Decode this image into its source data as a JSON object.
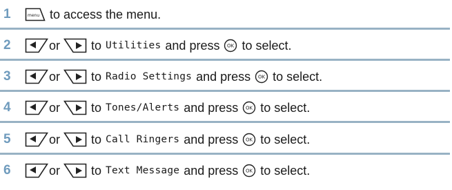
{
  "steps": [
    {
      "number": "1",
      "menu_icon_label": "menu",
      "text": "to access the menu."
    },
    {
      "number": "2",
      "or": "or",
      "to": "to",
      "item": "Utilities",
      "press": "and press",
      "select": "to select.",
      "ok_icon_label": "OK"
    },
    {
      "number": "3",
      "or": "or",
      "to": "to",
      "item": "Radio Settings",
      "press": "and press",
      "select": "to select.",
      "ok_icon_label": "OK"
    },
    {
      "number": "4",
      "or": "or",
      "to": "to",
      "item": "Tones/Alerts",
      "press": "and press",
      "select": "to select.",
      "ok_icon_label": "OK"
    },
    {
      "number": "5",
      "or": "or",
      "to": "to",
      "item": "Call Ringers",
      "press": "and press",
      "select": "to select.",
      "ok_icon_label": "OK"
    },
    {
      "number": "6",
      "or": "or",
      "to": "to",
      "item": "Text Message",
      "press": "and press",
      "select": "to select.",
      "ok_icon_label": "OK"
    }
  ],
  "colors": {
    "step_number": "#6f9bbd",
    "divider": "#98b2c4",
    "text": "#1a1a1a"
  },
  "icons": [
    "menu-key-icon",
    "left-arrow-key-icon",
    "right-arrow-key-icon",
    "ok-key-icon"
  ]
}
